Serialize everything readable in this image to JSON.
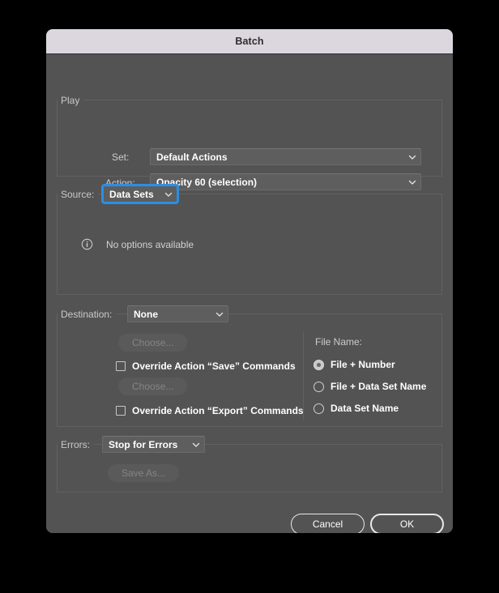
{
  "window": {
    "title": "Batch"
  },
  "play": {
    "group_label": "Play",
    "set_label": "Set:",
    "set_value": "Default Actions",
    "action_label": "Action:",
    "action_value": "Opacity 60 (selection)"
  },
  "source": {
    "label": "Source:",
    "value": "Data Sets",
    "info_icon": "info-circle-icon",
    "info_text": "No options available"
  },
  "destination": {
    "label": "Destination:",
    "value": "None",
    "choose_save_label": "Choose...",
    "override_save_label": "Override Action “Save” Commands",
    "choose_export_label": "Choose...",
    "override_export_label": "Override Action “Export” Commands"
  },
  "file_name": {
    "label": "File Name:",
    "options": [
      {
        "label": "File + Number",
        "selected": true
      },
      {
        "label": "File + Data Set Name",
        "selected": false
      },
      {
        "label": "Data Set Name",
        "selected": false
      }
    ]
  },
  "errors": {
    "label": "Errors:",
    "value": "Stop for Errors",
    "save_as_label": "Save As..."
  },
  "footer": {
    "cancel_label": "Cancel",
    "ok_label": "OK"
  },
  "colors": {
    "window_bg": "#535353",
    "title_bg": "#dcd7de",
    "field_bg": "#5e5e5e",
    "focus_ring": "#2b8fe3",
    "text": "#ffffff",
    "label": "#cccccc",
    "disabled_text": "#858585",
    "group_border": "#616161"
  },
  "icons": {
    "chevron_down": "chevron-down-icon"
  }
}
